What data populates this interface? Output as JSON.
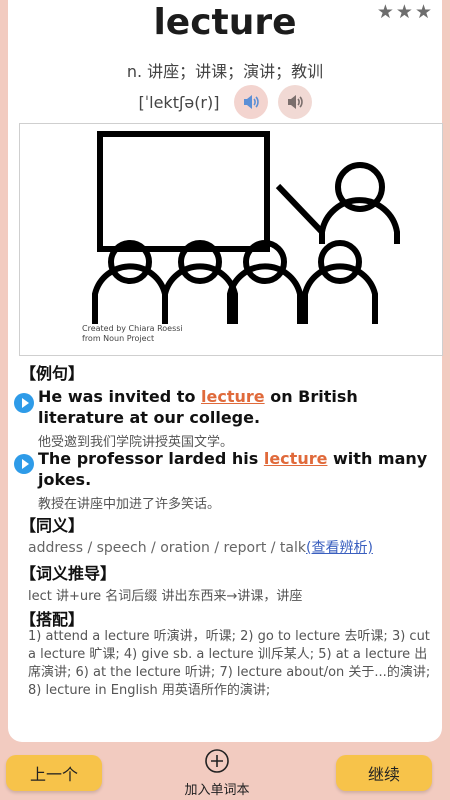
{
  "word": "lecture",
  "definition": "n. 讲座；讲课；演讲；教训",
  "phonetic": "[ˈlektʃə(r)]",
  "image": {
    "credit_line1": "Created by Chiara Roessi",
    "credit_line2": "from Noun Project"
  },
  "rating": {
    "stars": 3,
    "icon": "star-icon"
  },
  "sections": {
    "examples_title": "【例句】",
    "synonyms_title": "【同义】",
    "etymology_title": "【词义推导】",
    "collocations_title": "【搭配】"
  },
  "examples": [
    {
      "before": "He was invited to ",
      "keyword": "lecture",
      "after": " on British literature at our college.",
      "zh": "他受邀到我们学院讲授英国文学。"
    },
    {
      "before": "The professor larded his ",
      "keyword": "lecture",
      "after": " with many jokes.",
      "zh": "教授在讲座中加进了许多笑话。"
    }
  ],
  "synonyms": {
    "text": "address / speech / oration / report / talk",
    "link": "(查看辨析)"
  },
  "etymology": "lect 讲+ure 名词后缀 讲出东西来→讲课，讲座",
  "collocations": "1) attend a lecture 听演讲，听课; 2) go to lecture 去听课; 3) cut a lecture 旷课; 4) give sb. a lecture 训斥某人; 5) at a lecture 出席演讲; 6) at the lecture 听讲; 7) lecture about/on 关于...的演讲; 8) lecture in English 用英语所作的演讲;",
  "buttons": {
    "prev": "上一个",
    "add": "加入单词本",
    "next": "继续"
  },
  "colors": {
    "accent": "#f7c34a",
    "keyword": "#e06a3b",
    "play": "#2e9be8",
    "link": "#3a5fbf",
    "background": "#f2cbc0"
  }
}
